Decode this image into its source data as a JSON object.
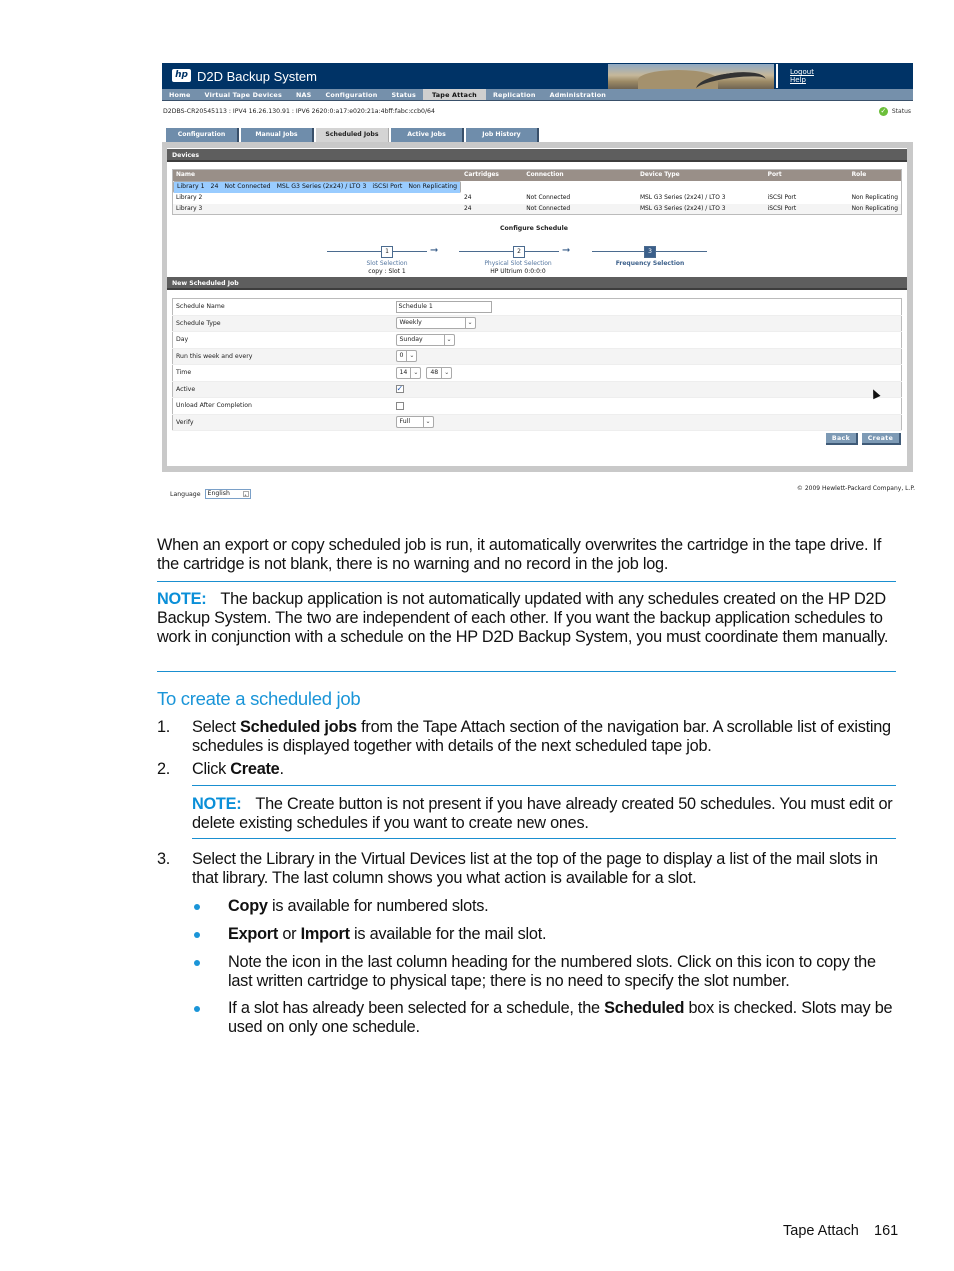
{
  "ui": {
    "app_title": "D2D Backup System",
    "header_links": [
      "Logout",
      "Help"
    ],
    "nav": [
      "Home",
      "Virtual Tape Devices",
      "NAS",
      "Configuration",
      "Status",
      "Tape Attach",
      "Replication",
      "Administration"
    ],
    "nav_active": "Tape Attach",
    "hostline": "D2DBS-CR20545113 : IPV4 16.26.130.91 : IPV6 2620:0:a17:e020:21a:4bff:fabc:ccb0/64",
    "status_label": "Status",
    "tabs": [
      "Configuration",
      "Manual Jobs",
      "Scheduled Jobs",
      "Active Jobs",
      "Job History"
    ],
    "tab_active": "Scheduled Jobs",
    "devices": {
      "title": "Devices",
      "columns": [
        "Name",
        "Cartridges",
        "Connection",
        "Device Type",
        "Port",
        "Role"
      ],
      "rows": [
        [
          "Library 1",
          "24",
          "Not Connected",
          "MSL G3 Series (2x24) / LTO 3",
          "iSCSI Port",
          "Non Replicating"
        ],
        [
          "Library 2",
          "24",
          "Not Connected",
          "MSL G3 Series (2x24) / LTO 3",
          "iSCSI Port",
          "Non Replicating"
        ],
        [
          "Library 3",
          "24",
          "Not Connected",
          "MSL G3 Series (2x24) / LTO 3",
          "iSCSI Port",
          "Non Replicating"
        ]
      ],
      "selected_row": 0
    },
    "wizard": {
      "title": "Configure Schedule",
      "steps": [
        {
          "num": "1",
          "label": "Slot Selection",
          "sub": "copy : Slot 1"
        },
        {
          "num": "2",
          "label": "Physical Slot Selection",
          "sub": "HP Ultrium 0:0:0:0"
        },
        {
          "num": "3",
          "label": "Frequency Selection",
          "sub": ""
        }
      ],
      "current_step": 3
    },
    "new_job": {
      "title": "New Scheduled Job",
      "fields": {
        "schedule_name": {
          "label": "Schedule Name",
          "value": "Schedule 1"
        },
        "schedule_type": {
          "label": "Schedule Type",
          "value": "Weekly"
        },
        "day": {
          "label": "Day",
          "value": "Sunday"
        },
        "run_every": {
          "label": "Run this week and every",
          "value": "0"
        },
        "time": {
          "label": "Time",
          "hour": "14",
          "minute": "48"
        },
        "active": {
          "label": "Active",
          "checked": true
        },
        "unload": {
          "label": "Unload After Completion",
          "checked": false
        },
        "verify": {
          "label": "Verify",
          "value": "Full"
        }
      },
      "back_label": "Back",
      "create_label": "Create"
    },
    "language_label": "Language",
    "language_value": "English",
    "copyright": "© 2009 Hewlett-Packard Company, L.P."
  },
  "doc": {
    "para1": "When an export or copy scheduled job is run, it automatically overwrites the cartridge in the tape drive. If the cartridge is not blank, there is no warning and no record in the job log.",
    "note1_label": "NOTE:",
    "note1_text": "The backup application is not automatically updated with any schedules created on the HP D2D Backup System. The two are independent of each other. If you want the backup application schedules to work in conjunction with a schedule on the HP D2D Backup System, you must coordinate them manually.",
    "heading": "To create a scheduled job",
    "step1_num": "1.",
    "step1_pre": "Select ",
    "step1_bold": "Scheduled jobs",
    "step1_post": " from the Tape Attach section of the navigation bar. A scrollable list of existing schedules is displayed together with details of the next scheduled tape job.",
    "step2_num": "2.",
    "step2_pre": "Click ",
    "step2_bold": "Create",
    "step2_post": ".",
    "note2_label": "NOTE:",
    "note2_text": "The Create button is not present if you have already created 50 schedules. You must edit or delete existing schedules if you want to create new ones.",
    "step3_num": "3.",
    "step3_text": "Select the Library in the Virtual Devices list at the top of the page to display a list of the mail slots in that library. The last column shows you what action is available for a slot.",
    "bullet1_bold": "Copy",
    "bullet1_post": " is available for numbered slots.",
    "bullet2_bold1": "Export",
    "bullet2_mid": " or ",
    "bullet2_bold2": "Import",
    "bullet2_post": " is available for the mail slot.",
    "bullet3_text": "Note the icon in the last column heading for the numbered slots. Click on this icon to copy the last written cartridge to physical tape; there is no need to specify the slot number.",
    "bullet4_pre": "If a slot has already been selected for a schedule, the ",
    "bullet4_bold": "Scheduled",
    "bullet4_post": " box is checked. Slots may be used on only one schedule."
  },
  "footer": {
    "section": "Tape Attach",
    "page": "161"
  }
}
